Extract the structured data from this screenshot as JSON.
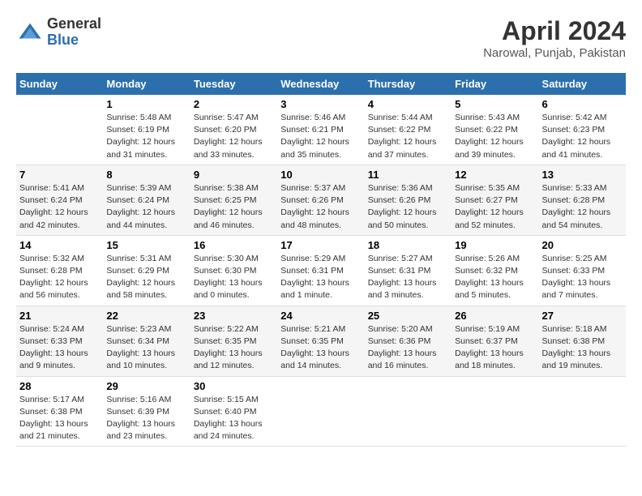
{
  "header": {
    "logo_general": "General",
    "logo_blue": "Blue",
    "month_title": "April 2024",
    "location": "Narowal, Punjab, Pakistan"
  },
  "weekdays": [
    "Sunday",
    "Monday",
    "Tuesday",
    "Wednesday",
    "Thursday",
    "Friday",
    "Saturday"
  ],
  "weeks": [
    [
      {
        "day": "",
        "info": ""
      },
      {
        "day": "1",
        "info": "Sunrise: 5:48 AM\nSunset: 6:19 PM\nDaylight: 12 hours\nand 31 minutes."
      },
      {
        "day": "2",
        "info": "Sunrise: 5:47 AM\nSunset: 6:20 PM\nDaylight: 12 hours\nand 33 minutes."
      },
      {
        "day": "3",
        "info": "Sunrise: 5:46 AM\nSunset: 6:21 PM\nDaylight: 12 hours\nand 35 minutes."
      },
      {
        "day": "4",
        "info": "Sunrise: 5:44 AM\nSunset: 6:22 PM\nDaylight: 12 hours\nand 37 minutes."
      },
      {
        "day": "5",
        "info": "Sunrise: 5:43 AM\nSunset: 6:22 PM\nDaylight: 12 hours\nand 39 minutes."
      },
      {
        "day": "6",
        "info": "Sunrise: 5:42 AM\nSunset: 6:23 PM\nDaylight: 12 hours\nand 41 minutes."
      }
    ],
    [
      {
        "day": "7",
        "info": "Sunrise: 5:41 AM\nSunset: 6:24 PM\nDaylight: 12 hours\nand 42 minutes."
      },
      {
        "day": "8",
        "info": "Sunrise: 5:39 AM\nSunset: 6:24 PM\nDaylight: 12 hours\nand 44 minutes."
      },
      {
        "day": "9",
        "info": "Sunrise: 5:38 AM\nSunset: 6:25 PM\nDaylight: 12 hours\nand 46 minutes."
      },
      {
        "day": "10",
        "info": "Sunrise: 5:37 AM\nSunset: 6:26 PM\nDaylight: 12 hours\nand 48 minutes."
      },
      {
        "day": "11",
        "info": "Sunrise: 5:36 AM\nSunset: 6:26 PM\nDaylight: 12 hours\nand 50 minutes."
      },
      {
        "day": "12",
        "info": "Sunrise: 5:35 AM\nSunset: 6:27 PM\nDaylight: 12 hours\nand 52 minutes."
      },
      {
        "day": "13",
        "info": "Sunrise: 5:33 AM\nSunset: 6:28 PM\nDaylight: 12 hours\nand 54 minutes."
      }
    ],
    [
      {
        "day": "14",
        "info": "Sunrise: 5:32 AM\nSunset: 6:28 PM\nDaylight: 12 hours\nand 56 minutes."
      },
      {
        "day": "15",
        "info": "Sunrise: 5:31 AM\nSunset: 6:29 PM\nDaylight: 12 hours\nand 58 minutes."
      },
      {
        "day": "16",
        "info": "Sunrise: 5:30 AM\nSunset: 6:30 PM\nDaylight: 13 hours\nand 0 minutes."
      },
      {
        "day": "17",
        "info": "Sunrise: 5:29 AM\nSunset: 6:31 PM\nDaylight: 13 hours\nand 1 minute."
      },
      {
        "day": "18",
        "info": "Sunrise: 5:27 AM\nSunset: 6:31 PM\nDaylight: 13 hours\nand 3 minutes."
      },
      {
        "day": "19",
        "info": "Sunrise: 5:26 AM\nSunset: 6:32 PM\nDaylight: 13 hours\nand 5 minutes."
      },
      {
        "day": "20",
        "info": "Sunrise: 5:25 AM\nSunset: 6:33 PM\nDaylight: 13 hours\nand 7 minutes."
      }
    ],
    [
      {
        "day": "21",
        "info": "Sunrise: 5:24 AM\nSunset: 6:33 PM\nDaylight: 13 hours\nand 9 minutes."
      },
      {
        "day": "22",
        "info": "Sunrise: 5:23 AM\nSunset: 6:34 PM\nDaylight: 13 hours\nand 10 minutes."
      },
      {
        "day": "23",
        "info": "Sunrise: 5:22 AM\nSunset: 6:35 PM\nDaylight: 13 hours\nand 12 minutes."
      },
      {
        "day": "24",
        "info": "Sunrise: 5:21 AM\nSunset: 6:35 PM\nDaylight: 13 hours\nand 14 minutes."
      },
      {
        "day": "25",
        "info": "Sunrise: 5:20 AM\nSunset: 6:36 PM\nDaylight: 13 hours\nand 16 minutes."
      },
      {
        "day": "26",
        "info": "Sunrise: 5:19 AM\nSunset: 6:37 PM\nDaylight: 13 hours\nand 18 minutes."
      },
      {
        "day": "27",
        "info": "Sunrise: 5:18 AM\nSunset: 6:38 PM\nDaylight: 13 hours\nand 19 minutes."
      }
    ],
    [
      {
        "day": "28",
        "info": "Sunrise: 5:17 AM\nSunset: 6:38 PM\nDaylight: 13 hours\nand 21 minutes."
      },
      {
        "day": "29",
        "info": "Sunrise: 5:16 AM\nSunset: 6:39 PM\nDaylight: 13 hours\nand 23 minutes."
      },
      {
        "day": "30",
        "info": "Sunrise: 5:15 AM\nSunset: 6:40 PM\nDaylight: 13 hours\nand 24 minutes."
      },
      {
        "day": "",
        "info": ""
      },
      {
        "day": "",
        "info": ""
      },
      {
        "day": "",
        "info": ""
      },
      {
        "day": "",
        "info": ""
      }
    ]
  ]
}
